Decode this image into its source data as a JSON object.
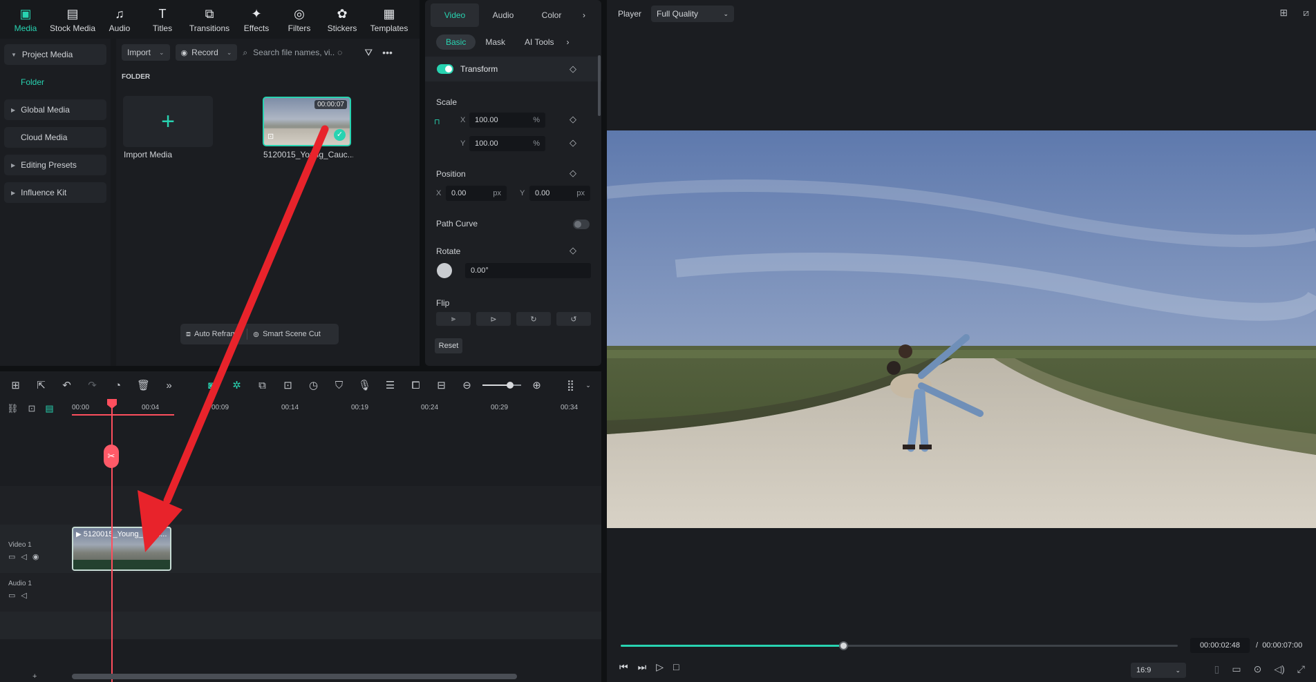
{
  "top_tabs": [
    {
      "label": "Media",
      "icon": "media-icon",
      "glyph": "▣",
      "active": true
    },
    {
      "label": "Stock Media",
      "icon": "stock-media-icon",
      "glyph": "▤"
    },
    {
      "label": "Audio",
      "icon": "music-note-icon",
      "glyph": "♫"
    },
    {
      "label": "Titles",
      "icon": "text-icon",
      "glyph": "T"
    },
    {
      "label": "Transitions",
      "icon": "transition-icon",
      "glyph": "⧉"
    },
    {
      "label": "Effects",
      "icon": "sparkle-icon",
      "glyph": "✦"
    },
    {
      "label": "Filters",
      "icon": "filter-icon",
      "glyph": "◎"
    },
    {
      "label": "Stickers",
      "icon": "sticker-icon",
      "glyph": "✿"
    },
    {
      "label": "Templates",
      "icon": "template-icon",
      "glyph": "▦"
    }
  ],
  "sidebar": {
    "project_media": "Project Media",
    "folder": "Folder",
    "global_media": "Global Media",
    "cloud_media": "Cloud Media",
    "editing_presets": "Editing Presets",
    "influence_kit": "Influence Kit"
  },
  "media_toolbar": {
    "import": "Import",
    "record": "Record",
    "search_placeholder": "Search file names, vi..."
  },
  "media": {
    "folder_label": "FOLDER",
    "import_label": "Import Media",
    "clip_label": "5120015_Young_Cauc...",
    "clip_duration": "00:00:07"
  },
  "scene_bar": {
    "auto_reframe": "Auto Reframe",
    "smart_cut": "Smart Scene Cut"
  },
  "properties": {
    "tabs": [
      "Video",
      "Audio",
      "Color"
    ],
    "subtabs": [
      "Basic",
      "Mask",
      "AI Tools"
    ],
    "transform": "Transform",
    "scale": "Scale",
    "scale_x": "100.00",
    "scale_y": "100.00",
    "percent": "%",
    "position": "Position",
    "pos_x": "0.00",
    "pos_y": "0.00",
    "px": "px",
    "path_curve": "Path Curve",
    "rotate": "Rotate",
    "rotate_value": "0.00°",
    "flip": "Flip",
    "reset": "Reset",
    "x": "X",
    "y": "Y"
  },
  "timeline": {
    "ticks": [
      "00:00",
      "00:04",
      "00:09",
      "00:14",
      "00:19",
      "00:24",
      "00:29",
      "00:34"
    ],
    "video_track": "Video 1",
    "audio_track": "Audio 1",
    "clip_title": "5120015_Young_Cauc..."
  },
  "player": {
    "label": "Player",
    "quality": "Full Quality",
    "current_time": "00:00:02:48",
    "separator": "/",
    "total_time": "00:00:07:00",
    "ratio": "16:9",
    "progress": 0.4
  },
  "colors": {
    "accent": "#28d3b1",
    "playhead": "#ff4f5e",
    "arrow": "#e8232b"
  }
}
